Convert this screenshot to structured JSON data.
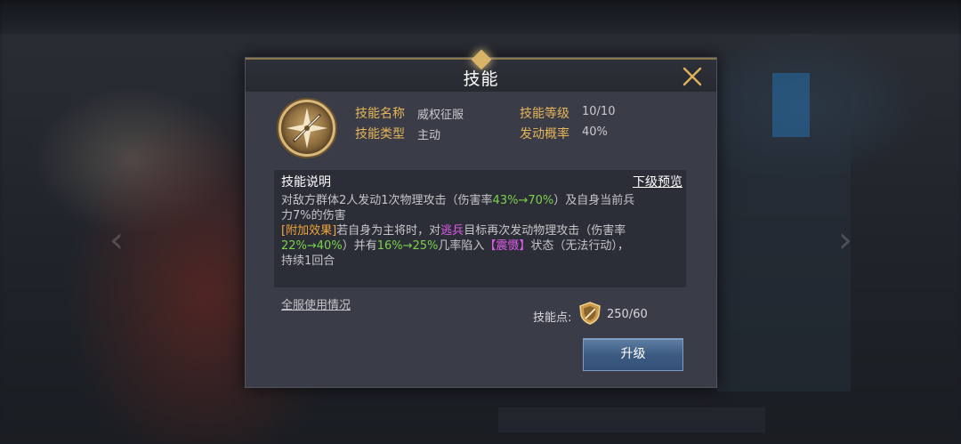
{
  "dialog": {
    "title": "技能",
    "close_icon": "close-icon"
  },
  "skill": {
    "icon": "compass-sword-icon",
    "name_label": "技能名称",
    "name_value": "威权征服",
    "level_label": "技能等级",
    "level_value": "10/10",
    "type_label": "技能类型",
    "type_value": "主动",
    "rate_label": "发动概率",
    "rate_value": "40%"
  },
  "description": {
    "title": "技能说明",
    "preview_link": "下级预览",
    "line1_a": "对敌方群体2人发动1次物理攻击（伤害率",
    "line1_b": "43%→70%",
    "line1_c": "）及自身当前兵",
    "line2": "力7%的伤害",
    "line3_a": "[附加效果]",
    "line3_b": "若自身为主将时，对",
    "line3_c": "逃兵",
    "line3_d": "目标再次发动物理攻击（伤害率",
    "line4_a": "22%→40%",
    "line4_b": "）并有",
    "line4_c": "16%→25%",
    "line4_d": "几率陷入",
    "line4_e": "【震慑】",
    "line4_f": "状态（无法行动），",
    "line5": "持续1回合"
  },
  "footer": {
    "server_usage_link": "全服使用情况",
    "points_label": "技能点:",
    "points_icon": "skill-point-shield-icon",
    "points_value": "250/60",
    "upgrade_label": "升级"
  },
  "colors": {
    "label_gold": "#e7b558",
    "highlight_green": "#7bd24a",
    "highlight_magenta": "#e35bf0",
    "highlight_orange": "#f2a33a",
    "button_blue": "#3d5c82"
  }
}
